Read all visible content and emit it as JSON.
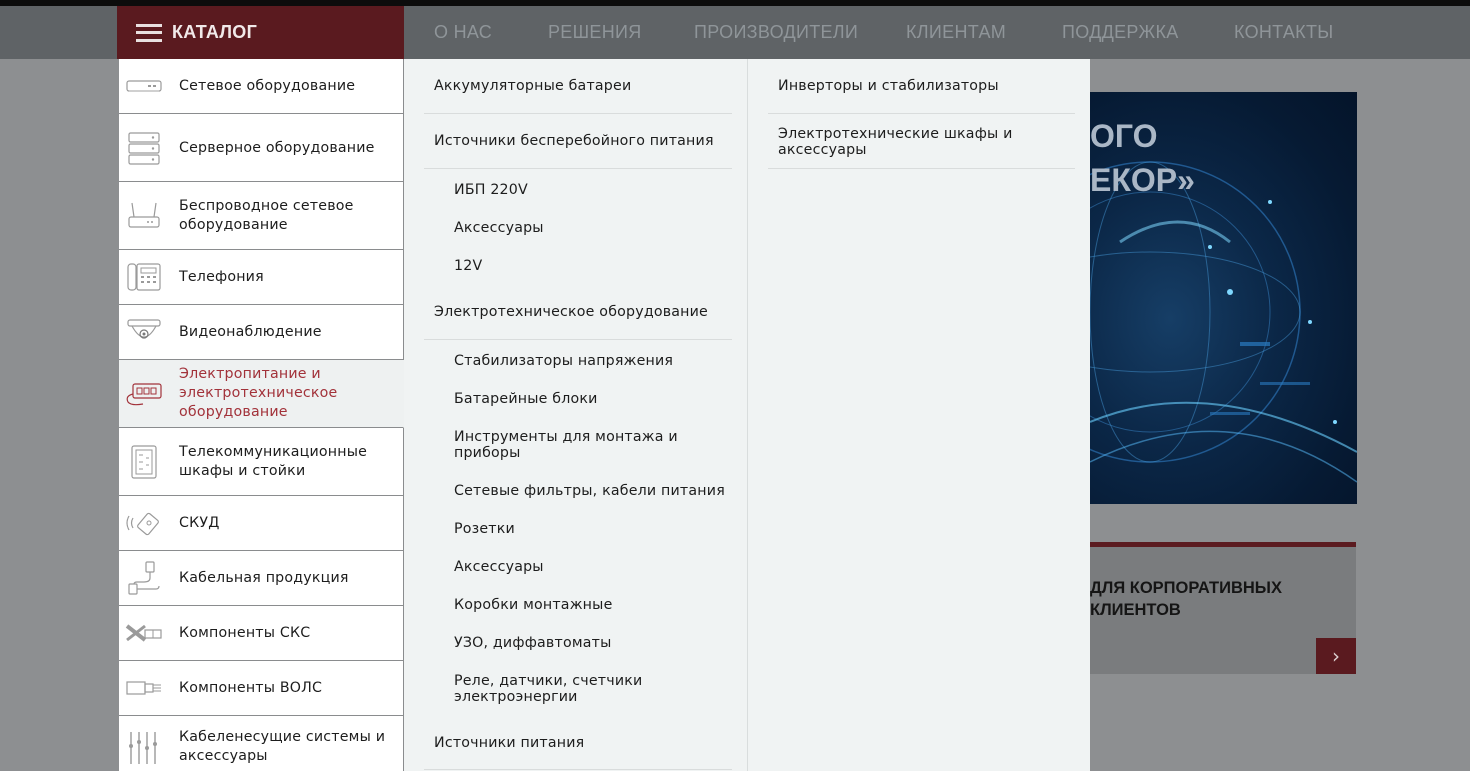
{
  "header": {
    "catalog_label": "КАТАЛОГ",
    "nav": [
      "О НАС",
      "РЕШЕНИЯ",
      "ПРОИЗВОДИТЕЛИ",
      "КЛИЕНТАМ",
      "ПОДДЕРЖКА",
      "КОНТАКТЫ"
    ]
  },
  "catalog": {
    "items": [
      {
        "label": "Сетевое оборудование",
        "icon": "network-switch-icon"
      },
      {
        "label": "Серверное оборудование",
        "icon": "server-rack-icon"
      },
      {
        "label": "Беспроводное сетевое оборудование",
        "icon": "wifi-router-icon"
      },
      {
        "label": "Телефония",
        "icon": "phone-icon"
      },
      {
        "label": "Видеонаблюдение",
        "icon": "dome-camera-icon"
      },
      {
        "label": "Электропитание и электротехническое оборудование",
        "icon": "power-supply-icon",
        "active": true
      },
      {
        "label": "Телекоммуникационные шкафы и стойки",
        "icon": "cabinet-icon"
      },
      {
        "label": "СКУД",
        "icon": "access-card-icon"
      },
      {
        "label": "Кабельная продукция",
        "icon": "cable-icon"
      },
      {
        "label": "Компоненты СКС",
        "icon": "scs-components-icon"
      },
      {
        "label": "Компоненты ВОЛС",
        "icon": "fiber-connector-icon"
      },
      {
        "label": "Кабеленесущие системы и аксессуары",
        "icon": "cable-tray-icon"
      }
    ]
  },
  "submenu": {
    "col1": [
      {
        "label": "Аккумуляторные батареи",
        "level": 1
      },
      {
        "label": "Источники бесперебойного питания",
        "level": 1
      },
      {
        "label": "ИБП 220V",
        "level": 2
      },
      {
        "label": "Аксессуары",
        "level": 2
      },
      {
        "label": "12V",
        "level": 2
      },
      {
        "label": "Электротехническое оборудование",
        "level": 1
      },
      {
        "label": "Стабилизаторы напряжения",
        "level": 2
      },
      {
        "label": "Батарейные блоки",
        "level": 2
      },
      {
        "label": "Инструменты для монтажа и приборы",
        "level": 2
      },
      {
        "label": "Сетевые фильтры, кабели питания",
        "level": 2
      },
      {
        "label": "Розетки",
        "level": 2
      },
      {
        "label": "Аксессуары",
        "level": 2
      },
      {
        "label": "Коробки монтажные",
        "level": 2
      },
      {
        "label": "УЗО, диффавтоматы",
        "level": 2
      },
      {
        "label": "Реле, датчики, счетчики электроэнергии",
        "level": 2
      },
      {
        "label": "Источники питания",
        "level": 1
      }
    ],
    "col2": [
      {
        "label": "Инверторы и стабилизаторы",
        "level": 1
      },
      {
        "label": "Электротехнические шкафы и аксессуары",
        "level": 1
      }
    ]
  },
  "background": {
    "banner_line1": "ОГО",
    "banner_line2": "ЕКОР»",
    "promo_text": "ДЛЯ КОРПОРАТИВНЫХ КЛИЕНТОВ",
    "promo_arrow": "›"
  },
  "colors": {
    "header_bg": "#5f6366",
    "catalog_bg": "#5a1a1f",
    "active_text": "#a2323a",
    "submenu_bg": "#f0f3f3"
  }
}
